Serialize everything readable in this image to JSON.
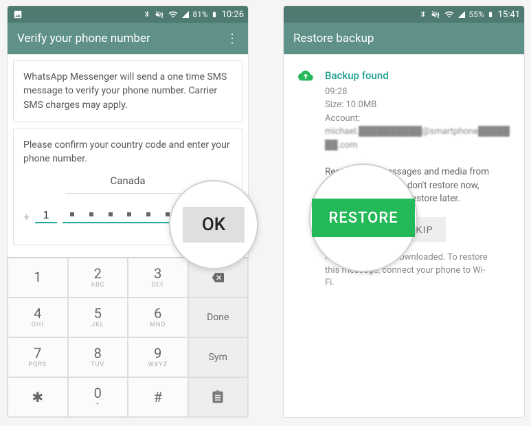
{
  "left": {
    "status": {
      "battery": "81%",
      "time": "10:26"
    },
    "title": "Verify your phone number",
    "info_text": "WhatsApp Messenger will send a one time SMS message to verify your phone number. Carrier SMS charges may apply.",
    "confirm_text": "Please confirm your country code and enter your phone number.",
    "country": "Canada",
    "plus": "+",
    "cc_value": "1",
    "ok_label": "OK",
    "keypad": {
      "row1": [
        {
          "d": "1",
          "l": ""
        },
        {
          "d": "2",
          "l": "ABC"
        },
        {
          "d": "3",
          "l": "DEF"
        }
      ],
      "row2": [
        {
          "d": "4",
          "l": "GHI"
        },
        {
          "d": "5",
          "l": "JKL"
        },
        {
          "d": "6",
          "l": "MNO"
        }
      ],
      "row3": [
        {
          "d": "7",
          "l": "PQRS"
        },
        {
          "d": "8",
          "l": "TUV"
        },
        {
          "d": "9",
          "l": "WXYZ"
        }
      ],
      "row4": [
        {
          "d": "✱",
          "l": ""
        },
        {
          "d": "0",
          "l": "+"
        },
        {
          "d": "#",
          "l": ""
        }
      ],
      "done": "Done",
      "sym": "Sym"
    },
    "ok_big": "OK"
  },
  "right": {
    "status": {
      "battery": "55%",
      "time": "15:41"
    },
    "title": "Restore backup",
    "found_title": "Backup found",
    "found_time": "09:28",
    "found_size": "Size: 10.0MB",
    "found_account_label": "Account:",
    "found_account_value": "michael.██████████@smartphone███████.com",
    "restore_text": "Restore your messages and media from Google Drive. If you don't restore now, you won't be able to restore later.",
    "skip_label": "SKIP",
    "wifi_note": "Media will not be downloaded. To restore this message, connect your phone to Wi-Fi.",
    "restore_big": "RESTORE"
  }
}
